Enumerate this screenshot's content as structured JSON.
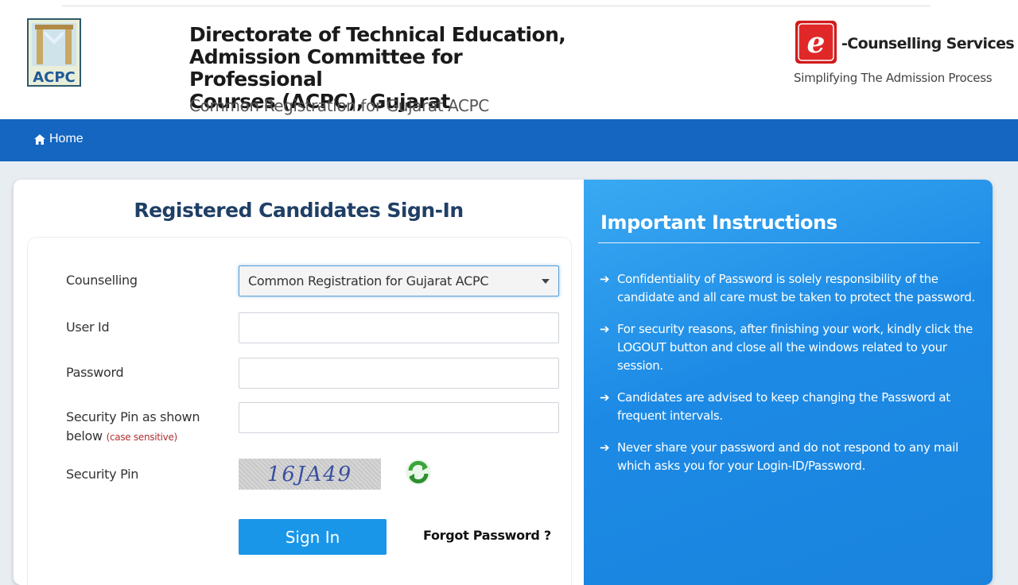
{
  "header": {
    "logo_text": "ACPC",
    "title_lines": [
      "Directorate of Technical Education,",
      "Admission Committee for Professional",
      "Courses (ACPC), Gujarat"
    ],
    "subtitle": "Common Registration for Gujarat ACPC",
    "ecounselling": {
      "logo_letter": "e",
      "title": "-Counselling Services",
      "tagline": "Simplifying The Admission Process"
    }
  },
  "nav": {
    "home_icon": "home-icon",
    "home_label": "Home"
  },
  "signin": {
    "title": "Registered Candidates Sign-In",
    "counselling_label": "Counselling",
    "counselling_value": "Common Registration for Gujarat ACPC",
    "userid_label": "User Id",
    "userid_value": "",
    "password_label": "Password",
    "password_value": "",
    "secpin_label": "Security Pin as shown below",
    "secpin_note": "(case sensitive)",
    "secpin_value": "",
    "captcha_label": "Security Pin",
    "captcha_text": "16JA49",
    "refresh_icon": "refresh-icon",
    "signin_button": "Sign In",
    "forgot_link": "Forgot Password ?"
  },
  "instructions": {
    "title": "Important Instructions",
    "items": [
      "Confidentiality of Password is solely responsibility of the candidate and all care must be taken to protect the password.",
      "For security reasons, after finishing your work, kindly click the LOGOUT button and close all the windows related to your session.",
      "Candidates are advised to keep changing the Password at frequent intervals.",
      "Never share your password and do not respond to any mail which asks you for your Login-ID/Password."
    ]
  },
  "colors": {
    "nav_bg": "#1466c1",
    "panel_bg": "#1c8ae5",
    "button_bg": "#1a96e8",
    "title_color": "#1f3f66"
  }
}
